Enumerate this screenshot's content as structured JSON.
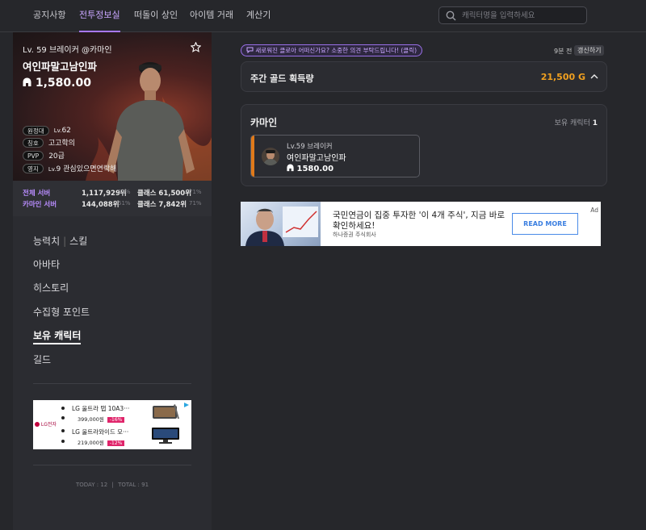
{
  "nav": {
    "items": [
      {
        "label": "공지사항",
        "active": false
      },
      {
        "label": "전투정보실",
        "active": true
      },
      {
        "label": "떠돌이 상인",
        "active": false
      },
      {
        "label": "아이템 거래",
        "active": false
      },
      {
        "label": "계산기",
        "active": false
      }
    ],
    "search_placeholder": "캐릭터명을 입력하세요"
  },
  "profile": {
    "level_server": "Lv. 59 브레이커 @카마인",
    "name": "여인파말고남인파",
    "item_level": "1,580.00",
    "info": [
      {
        "chip": "원정대",
        "prefix": "Lv.",
        "value": "62"
      },
      {
        "chip": "칭호",
        "prefix": "",
        "value": "고고학의"
      },
      {
        "chip": "PVP",
        "prefix": "",
        "value": "20급"
      },
      {
        "chip": "영지",
        "prefix": "Lv.",
        "value": "9 관심있으면연락해"
      }
    ],
    "ranks": [
      {
        "label": "전체 서버",
        "rank": "1,117,929위",
        "pct": "51%",
        "class_rank": "클래스 61,500위",
        "class_pct": "71%"
      },
      {
        "label": "카마인 서버",
        "rank": "144,088위",
        "pct": "51%",
        "class_rank": "클래스 7,842위",
        "class_pct": "71%"
      }
    ]
  },
  "menu": {
    "ability": "능력치",
    "sep": "|",
    "skill": "스킬",
    "items": [
      "아바타",
      "히스토리",
      "수집형 포인트",
      "보유 캐릭터",
      "길드"
    ],
    "active": "보유 캐릭터"
  },
  "side_ad": {
    "brand": "LG전자",
    "products": [
      {
        "name": "LG 울트라 탭 10A3···",
        "price": "399,000원",
        "discount": "-16%"
      },
      {
        "name": "LG 울트라와이드 모···",
        "price": "219,000원",
        "discount": "-12%"
      }
    ]
  },
  "counter": {
    "today": "TODAY : 12",
    "sep": "|",
    "total": "TOTAL : 91"
  },
  "notice": "새로워진 클로아 어떠신가요? 소중한 의견 부탁드립니다! (클릭)",
  "updated": "9분 전",
  "refresh_label": "갱신하기",
  "gold": {
    "title": "주간 골드 획득량",
    "value": "21,500 G"
  },
  "characters": {
    "server": "카마인",
    "count_label": "보유 캐릭터",
    "count": "1",
    "list": [
      {
        "level_class": "Lv.59 브레이커",
        "name": "여인파말고남인파",
        "item_level": "1580.00"
      }
    ]
  },
  "ad": {
    "title": "국민연금이 집중 투자한 '이 4개 주식', 지금 바로 확인하세요!",
    "sub": "하나증권 주식회사",
    "button": "READ MORE",
    "tag": "Ad"
  },
  "colors": {
    "accent": "#a878ff",
    "gold": "#f0a020",
    "class_bar": "#e07a1a"
  }
}
